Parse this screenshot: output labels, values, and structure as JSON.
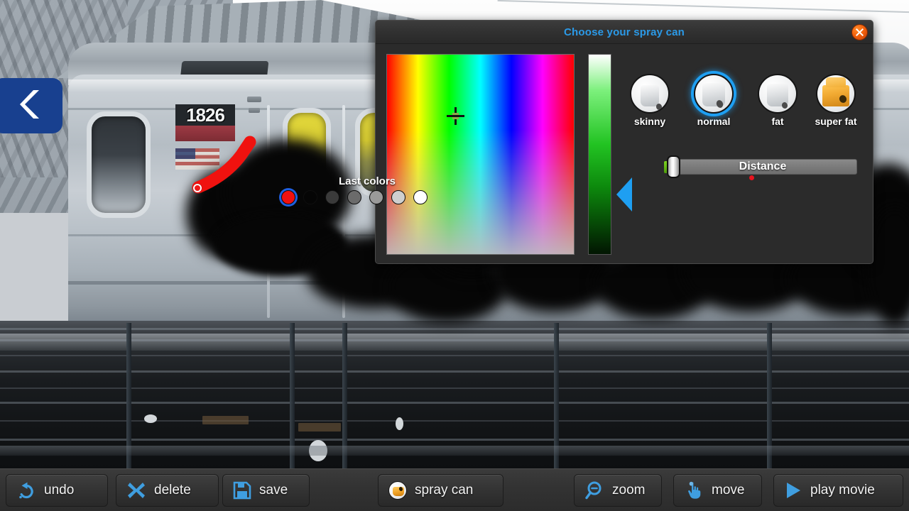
{
  "app": {
    "background_scene": "subway-train-photo",
    "train_number": "1826"
  },
  "back_button": {
    "icon": "chevron-left-icon",
    "label": "back"
  },
  "dialog": {
    "title": "Choose your spray can",
    "close_icon": "close-icon",
    "title_color": "#2b9ae8",
    "panel_color": "#2b2b2b"
  },
  "color_picker": {
    "crosshair_icon": "crosshair-icon",
    "brightness_marker_icon": "triangle-left-icon",
    "selected_color": "#e8141e"
  },
  "nozzles": {
    "items": [
      {
        "id": "skinny",
        "label": "skinny",
        "selected": false
      },
      {
        "id": "normal",
        "label": "normal",
        "selected": true
      },
      {
        "id": "fat",
        "label": "fat",
        "selected": false
      },
      {
        "id": "super-fat",
        "label": "super fat",
        "selected": false
      }
    ],
    "selection_color": "#1e9ff2"
  },
  "distance": {
    "label": "Distance",
    "value": 0,
    "fill_color": "#6cc51d"
  },
  "preview": {
    "dot_color": "#e8141e"
  },
  "last_colors": {
    "title": "Last colors",
    "swatches": [
      {
        "color": "#f01010",
        "selected": true
      },
      {
        "color": "#050505",
        "selected": false
      },
      {
        "color": "#3a3a3a",
        "selected": false
      },
      {
        "color": "#6b6b6b",
        "selected": false
      },
      {
        "color": "#9a9a9a",
        "selected": false
      },
      {
        "color": "#cfcfcf",
        "selected": false
      },
      {
        "color": "#ffffff",
        "selected": false
      }
    ]
  },
  "toolbar": {
    "buttons": [
      {
        "id": "undo",
        "label": "undo",
        "icon": "undo-arrow-icon"
      },
      {
        "id": "delete",
        "label": "delete",
        "icon": "x-cross-icon"
      },
      {
        "id": "save",
        "label": "save",
        "icon": "floppy-disk-icon"
      },
      {
        "id": "spray-can",
        "label": "spray can",
        "icon": "spray-can-icon"
      },
      {
        "id": "zoom",
        "label": "zoom",
        "icon": "magnifier-minus-icon"
      },
      {
        "id": "move",
        "label": "move",
        "icon": "pointing-hand-icon"
      },
      {
        "id": "play-movie",
        "label": "play movie",
        "icon": "play-triangle-icon"
      }
    ],
    "icon_color": "#3f9ee0"
  }
}
